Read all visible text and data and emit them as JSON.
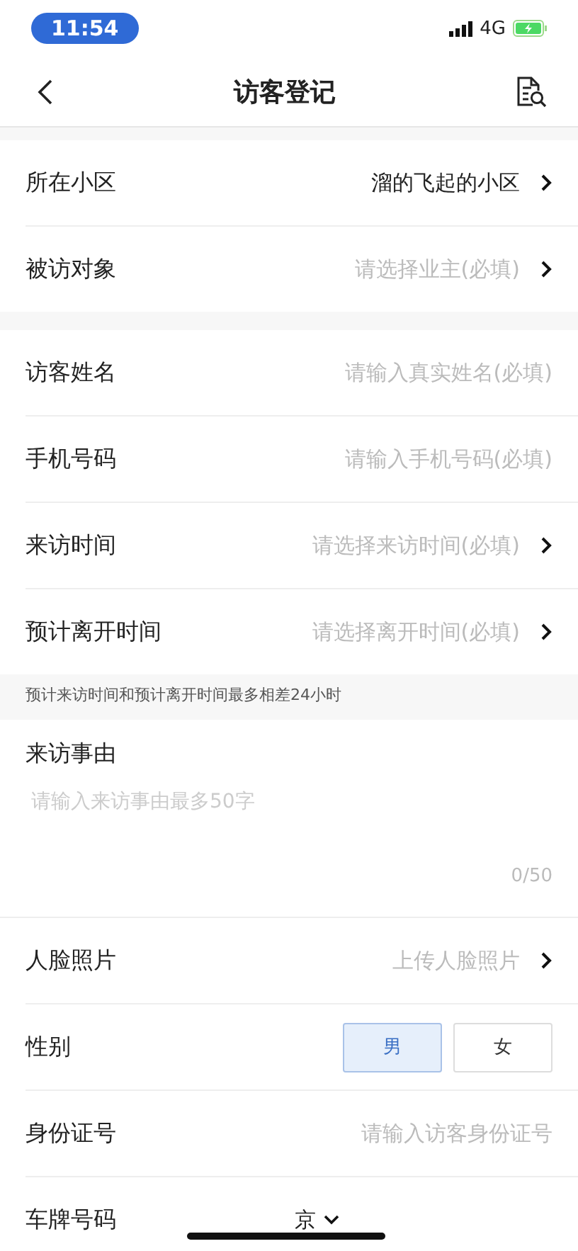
{
  "status_bar": {
    "time": "11:54",
    "network": "4G"
  },
  "nav": {
    "title": "访客登记"
  },
  "sections": [
    {
      "kind": "group",
      "rows": [
        {
          "kind": "select",
          "label": "所在小区",
          "value": "溜的飞起的小区"
        },
        {
          "kind": "select",
          "label": "被访对象",
          "placeholder": "请选择业主(必填)"
        }
      ]
    },
    {
      "kind": "group",
      "rows": [
        {
          "kind": "input",
          "label": "访客姓名",
          "placeholder": "请输入真实姓名(必填)"
        },
        {
          "kind": "input",
          "label": "手机号码",
          "placeholder": "请输入手机号码(必填)"
        },
        {
          "kind": "select",
          "label": "来访时间",
          "placeholder": "请选择来访时间(必填)"
        },
        {
          "kind": "select",
          "label": "预计离开时间",
          "placeholder": "请选择离开时间(必填)"
        }
      ]
    },
    {
      "kind": "note",
      "text": "预计来访时间和预计离开时间最多相差24小时"
    },
    {
      "kind": "textarea",
      "label": "来访事由",
      "placeholder": "请输入来访事由最多50字",
      "counter": "0/50"
    },
    {
      "kind": "group",
      "rows": [
        {
          "kind": "select",
          "label": "人脸照片",
          "placeholder": "上传人脸照片"
        },
        {
          "kind": "gender",
          "label": "性别",
          "options": [
            {
              "label": "男",
              "selected": true
            },
            {
              "label": "女",
              "selected": false
            }
          ]
        },
        {
          "kind": "input",
          "label": "身份证号",
          "placeholder": "请输入访客身份证号"
        },
        {
          "kind": "plate",
          "label": "车牌号码",
          "prefix": "京"
        }
      ]
    }
  ]
}
